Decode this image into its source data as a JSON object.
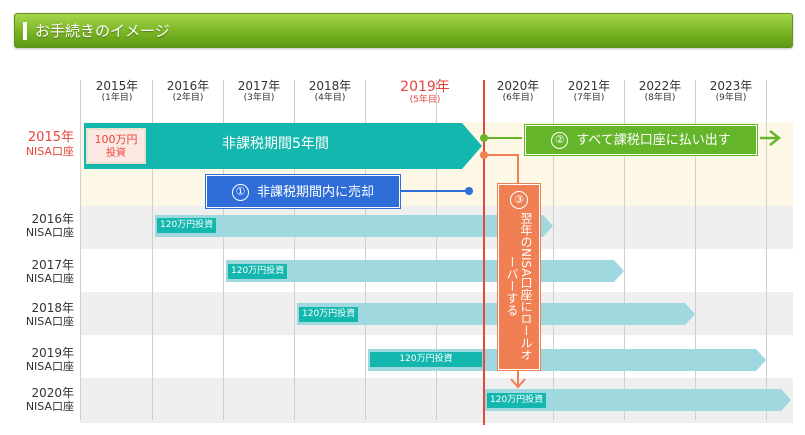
{
  "header": {
    "title": "お手続きのイメージ"
  },
  "years": [
    {
      "year": "2015年",
      "sub": "(1年目)",
      "highlight": false
    },
    {
      "year": "2016年",
      "sub": "(2年目)",
      "highlight": false
    },
    {
      "year": "2017年",
      "sub": "(3年目)",
      "highlight": false
    },
    {
      "year": "2018年",
      "sub": "(4年目)",
      "highlight": false
    },
    {
      "year": "2019年",
      "sub": "(5年目)",
      "highlight": true
    },
    {
      "year": "2020年",
      "sub": "(6年目)",
      "highlight": false
    },
    {
      "year": "2021年",
      "sub": "(7年目)",
      "highlight": false
    },
    {
      "year": "2022年",
      "sub": "(8年目)",
      "highlight": false
    },
    {
      "year": "2023年",
      "sub": "(9年目)",
      "highlight": false
    }
  ],
  "rows": [
    {
      "year": "2015年",
      "nisa": "NISA口座",
      "highlight": true
    },
    {
      "year": "2016年",
      "nisa": "NISA口座",
      "highlight": false
    },
    {
      "year": "2017年",
      "nisa": "NISA口座",
      "highlight": false
    },
    {
      "year": "2018年",
      "nisa": "NISA口座",
      "highlight": false
    },
    {
      "year": "2019年",
      "nisa": "NISA口座",
      "highlight": false
    },
    {
      "year": "2020年",
      "nisa": "NISA口座",
      "highlight": false
    }
  ],
  "box_2015": {
    "amount": "100万円",
    "invest": "投資"
  },
  "tax_free_label": "非課税期間5年間",
  "step1": {
    "num": "①",
    "label": "非課税期間内に売却"
  },
  "step2": {
    "num": "②",
    "label": "すべて課税口座に払い出す"
  },
  "step3": {
    "num": "③",
    "label": "翌年のNISA口座にロールオーバーする"
  },
  "badges": [
    "120万円投資",
    "120万円投資",
    "120万円投資",
    "120万円投資",
    "120万円投資"
  ],
  "colors": {
    "teal": "#14b7ae",
    "light_teal": "#9fd8df",
    "green": "#64b52a",
    "blue": "#2f6ed8",
    "orange": "#f08053",
    "red": "#e8453c"
  }
}
